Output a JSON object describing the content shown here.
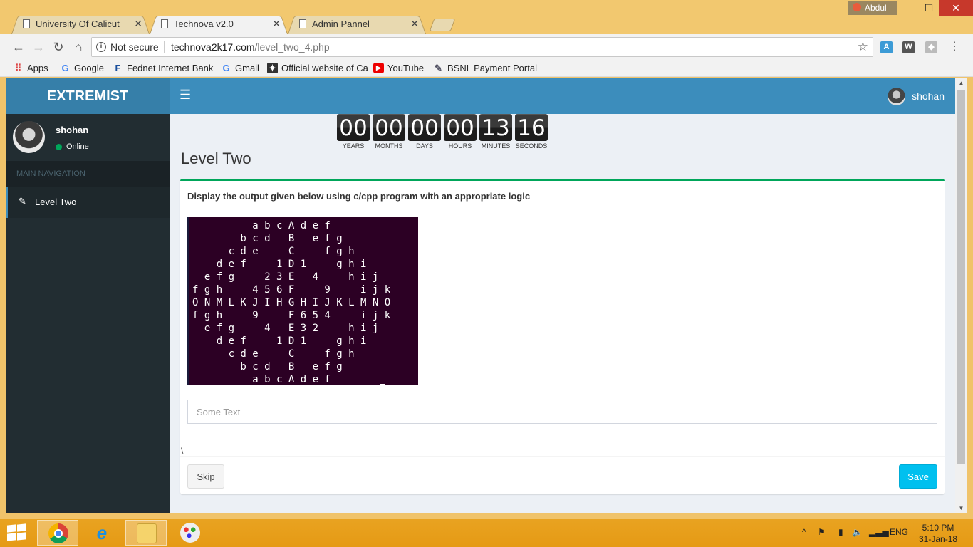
{
  "browser": {
    "tabs": [
      {
        "title": "University Of Calicut",
        "active": false
      },
      {
        "title": "Technova v2.0",
        "active": true
      },
      {
        "title": "Admin Pannel",
        "active": false
      }
    ],
    "profile_name": "Abdul",
    "window_controls": {
      "minimize": "–",
      "maximize": "☐",
      "close": "✕"
    },
    "security_label": "Not secure",
    "url_host": "technova2k17.com",
    "url_path": "/level_two_4.php",
    "bookmarks": [
      {
        "label": "Apps",
        "icon": "apps-grid-icon"
      },
      {
        "label": "Google",
        "icon": "google-icon"
      },
      {
        "label": "Fednet Internet Bank",
        "icon": "fednet-icon"
      },
      {
        "label": "Gmail",
        "icon": "google-icon"
      },
      {
        "label": "Official website of Ca",
        "icon": "website-icon"
      },
      {
        "label": "YouTube",
        "icon": "youtube-icon"
      },
      {
        "label": "BSNL Payment Portal",
        "icon": "bsnl-icon"
      }
    ]
  },
  "app": {
    "brand": "EXTREMIST",
    "accent": "#3c8dbc",
    "user": {
      "name": "shohan",
      "status": "Online"
    },
    "sidebar": {
      "header": "MAIN NAVIGATION",
      "items": [
        {
          "label": "Level Two",
          "icon": "edit-icon",
          "active": true
        }
      ]
    },
    "countdown": [
      {
        "value": "00",
        "label": "YEARS"
      },
      {
        "value": "00",
        "label": "MONTHS"
      },
      {
        "value": "00",
        "label": "DAYS"
      },
      {
        "value": "00",
        "label": "HOURS"
      },
      {
        "value": "13",
        "label": "MINUTES"
      },
      {
        "value": "16",
        "label": "SECONDS"
      }
    ],
    "page_title": "Level Two",
    "instruction": "Display the output given below using c/cpp program with an appropriate logic",
    "terminal_output": "          a b c A d e f\n        b c d   B   e f g\n      c d e     C     f g h\n    d e f     1 D 1     g h i\n  e f g     2 3 E   4     h i j\nf g h     4 5 6 F     9     i j k\nO N M L K J I H G H I J K L M N O\nf g h     9     F 6 5 4     i j k\n  e f g     4   E 3 2     h i j\n    d e f     1 D 1     g h i\n      c d e     C     f g h\n        b c d   B   e f g\n          a b c A d e f",
    "answer_placeholder": "Some Text",
    "answer_value": "",
    "stray_text": "\\",
    "buttons": {
      "skip": "Skip",
      "save": "Save"
    }
  },
  "taskbar": {
    "language": "ENG",
    "time": "5:10 PM",
    "date": "31-Jan-18"
  }
}
